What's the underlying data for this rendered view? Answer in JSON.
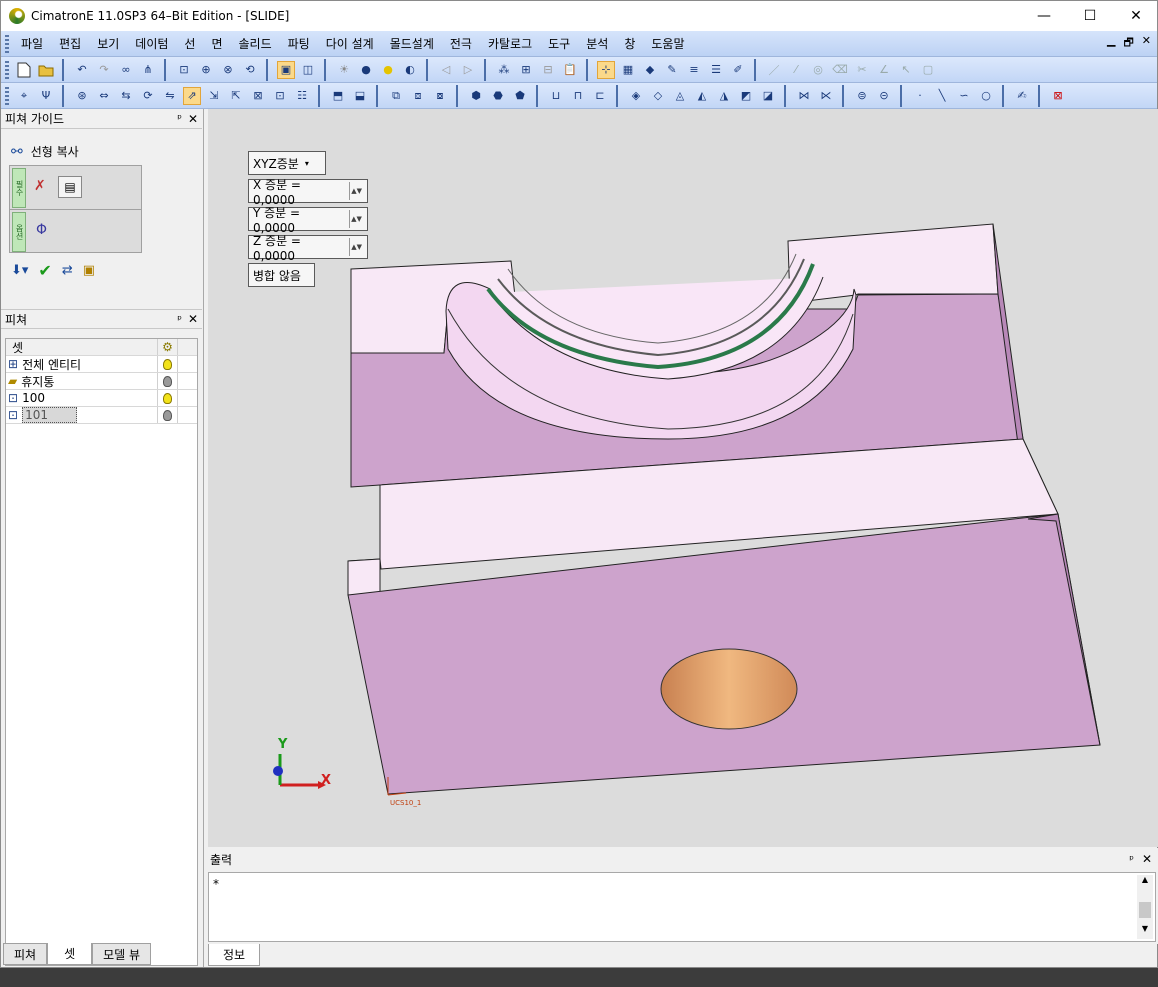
{
  "window": {
    "title": "CimatronE 11.0SP3 64–Bit Edition - [SLIDE]",
    "minimize": "—",
    "maximize": "☐",
    "close": "✕"
  },
  "menu": [
    "파일",
    "편집",
    "보기",
    "데이텀",
    "선",
    "면",
    "솔리드",
    "파팅",
    "다이 설계",
    "몰드설계",
    "전극",
    "카탈로그",
    "도구",
    "분석",
    "창",
    "도움말"
  ],
  "mdi_controls": [
    "▁",
    "🗗",
    "✕"
  ],
  "feature_guide": {
    "title": "피쳐 가이드",
    "pin": "ᵖ",
    "close": "✕",
    "command": "선형 복사"
  },
  "feature_panel": {
    "title": "피쳐",
    "column_header": "셋",
    "rows": [
      {
        "label": "전체 엔티티",
        "icon": "set-icon",
        "bulb": "on"
      },
      {
        "label": "휴지통",
        "icon": "trash-folder-icon",
        "bulb": "off"
      },
      {
        "label": "100",
        "icon": "set-icon",
        "bulb": "on"
      },
      {
        "label": "101",
        "icon": "set-icon",
        "bulb": "off",
        "selected": true
      }
    ]
  },
  "left_tabs": [
    "피쳐",
    "셋",
    "모델 뷰"
  ],
  "viewport": {
    "increment_mode": "XYZ증분",
    "x_increment": "X 증분 = 0,0000",
    "y_increment": "Y 증분 = 0,0000",
    "z_increment": "Z 증분 = 0,0000",
    "merge_option": "병합 않음",
    "axis_y": "Y",
    "axis_x": "X",
    "ucs_label": "UCS10_1"
  },
  "output": {
    "title": "출력",
    "content": "*",
    "tab": "정보"
  },
  "colors": {
    "part_face_top": "#f8e8f6",
    "part_face_side": "#cda3cc",
    "hole": "#e8a66a",
    "toolbar_bg": "#c2d6f6"
  }
}
